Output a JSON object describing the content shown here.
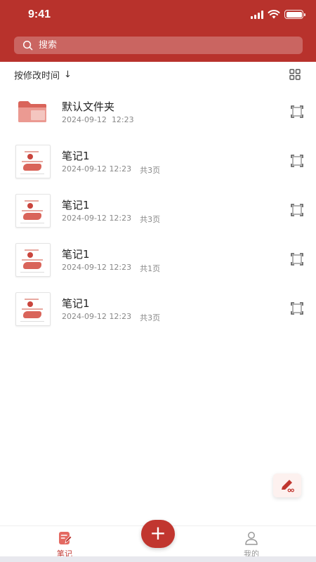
{
  "status_bar": {
    "time": "9:41"
  },
  "search": {
    "placeholder": "搜索"
  },
  "toolbar": {
    "sort_label": "按修改时间",
    "sort_arrow": "↓"
  },
  "items": [
    {
      "title": "默认文件夹",
      "date": "2024-09-12",
      "time": "12:23",
      "pages": "",
      "type": "folder"
    },
    {
      "title": "笔记1",
      "date": "2024-09-12",
      "time": "12:23",
      "pages": "共3页",
      "type": "note"
    },
    {
      "title": "笔记1",
      "date": "2024-09-12",
      "time": "12:23",
      "pages": "共3页",
      "type": "note"
    },
    {
      "title": "笔记1",
      "date": "2024-09-12",
      "time": "12:23",
      "pages": "共1页",
      "type": "note"
    },
    {
      "title": "笔记1",
      "date": "2024-09-12",
      "time": "12:23",
      "pages": "共3页",
      "type": "note"
    }
  ],
  "tabbar": {
    "notes_label": "笔记",
    "mine_label": "我的",
    "add_label": "+"
  },
  "colors": {
    "primary": "#b8322c",
    "accent": "#c1362f",
    "folder": "#e07a72"
  },
  "icons": {
    "search": "search-icon",
    "grid": "grid-view-icon",
    "select": "select-frame-icon",
    "edit": "pen-edit-icon",
    "notes_tab": "notes-icon",
    "mine_tab": "person-icon"
  }
}
